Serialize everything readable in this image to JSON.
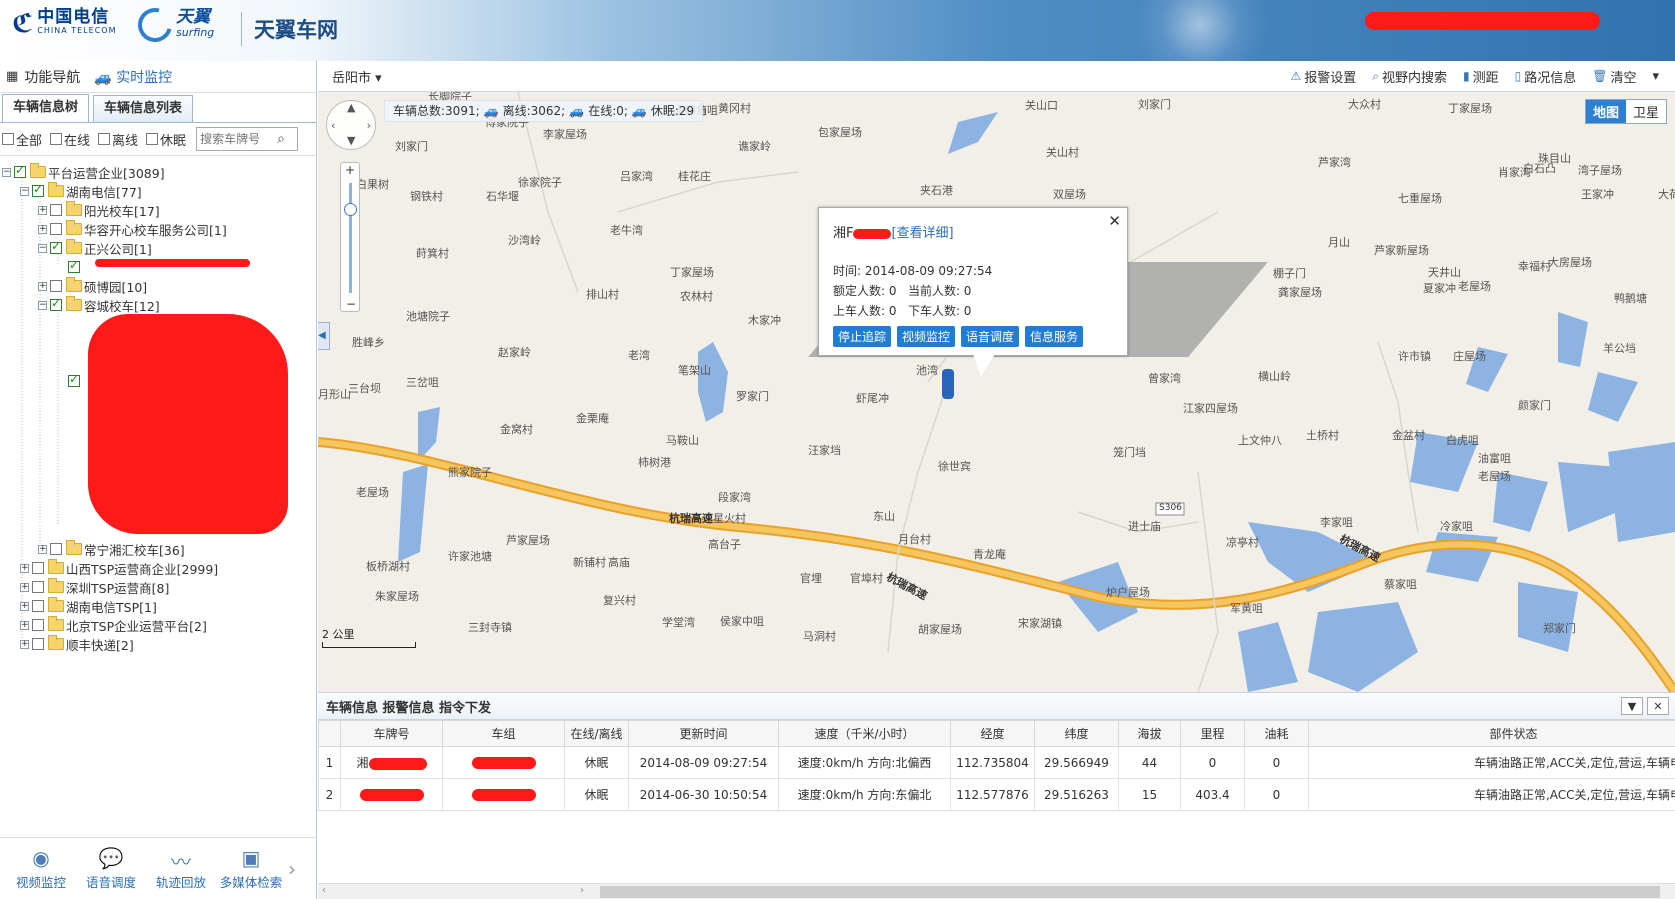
{
  "header": {
    "telecom_cn": "中国电信",
    "telecom_en": "CHINA TELECOM",
    "surfing_cn": "天翼",
    "surfing_en": "surfing",
    "app_title": "天翼车网"
  },
  "nav": {
    "func_nav": "功能导航",
    "realtime": "实时监控"
  },
  "left_tabs": [
    "车辆信息树",
    "车辆信息列表"
  ],
  "filters": {
    "all": "全部",
    "online": "在线",
    "offline": "离线",
    "sleep": "休眠",
    "search_placeholder": "搜索车牌号"
  },
  "tree": [
    {
      "label": "平台运营企业[3089]",
      "checked": true,
      "expanded": true
    },
    {
      "label": "湖南电信[77]",
      "checked": true,
      "expanded": true
    },
    {
      "label": "阳光校车[17]",
      "checked": false
    },
    {
      "label": "华容开心校车服务公司[1]",
      "checked": false
    },
    {
      "label": "正兴公司[1]",
      "checked": true,
      "expanded": true
    },
    {
      "label": "硕博园[10]",
      "checked": false
    },
    {
      "label": "容城校车[12]",
      "checked": true,
      "expanded": true
    },
    {
      "label": "常宁湘汇校车[36]",
      "checked": false
    },
    {
      "label": "山西TSP运营商企业[2999]",
      "checked": false
    },
    {
      "label": "深圳TSP运营商[8]",
      "checked": false
    },
    {
      "label": "湖南电信TSP[1]",
      "checked": false
    },
    {
      "label": "北京TSP企业运营平台[2]",
      "checked": false
    },
    {
      "label": "顺丰快递[2]",
      "checked": false
    }
  ],
  "left_footer": [
    "视频监控",
    "语音调度",
    "轨迹回放",
    "多媒体检索"
  ],
  "toolbar": {
    "city": "岳阳市",
    "tools": [
      "报警设置",
      "视野内搜索",
      "测距",
      "路况信息",
      "清空"
    ]
  },
  "map": {
    "stats": {
      "total": "车辆总数:3091;",
      "offline": "离线:3062;",
      "online": "在线:0;",
      "sleep": "休眠:29"
    },
    "type_map": "地图",
    "type_sat": "卫星",
    "scale_label": "2 公里",
    "popup": {
      "plate_prefix": "湘F",
      "detail_link": "[查看详细]",
      "time": "时间:  2014-08-09 09:27:54",
      "rated": "额定人数:  0",
      "current": "当前人数:  0",
      "on": "上车人数:  0",
      "off": "下车人数:  0",
      "buttons": [
        "停止追踪",
        "视频监控",
        "语音调度",
        "信息服务"
      ]
    },
    "places": [
      "子南角",
      "刘家门",
      "大众村",
      "丁家屋场",
      "关山口",
      "长脚院子",
      "傅家院子",
      "李家屋场",
      "刘家门",
      "谯家岭",
      "包家屋场",
      "关山村",
      "芦家湾",
      "珠目山",
      "白石凸",
      "肖家湾",
      "湾子屋场",
      "大荷塘",
      "白果树",
      "吕家湾",
      "桂花庄",
      "徐家院子",
      "钢铁村",
      "石华堰",
      "夹石港",
      "双屋场",
      "七重屋场",
      "王家冲",
      "芦家新屋场",
      "天井山",
      "大房屋场",
      "棚子门",
      "龚家屋场",
      "幸福村",
      "月山",
      "沙湾岭",
      "老牛湾",
      "黄冈村",
      "莳箕村",
      "丁家屋场",
      "农林村",
      "排山村",
      "夏家冲",
      "老屋场",
      "鸭鹅塘",
      "池塘院子",
      "木家冲",
      "胜峰乡",
      "赵家岭",
      "老湾",
      "笔架山",
      "月形山",
      "三岔咀",
      "许市镇",
      "庄屋场",
      "羊公垱",
      "曾家湾",
      "横山岭",
      "颜家门",
      "池湾",
      "虾尾冲",
      "罗家门",
      "金栗庵",
      "金窝村",
      "马鞍山",
      "汪家垱",
      "江家四屋场",
      "上文仲八",
      "土桥村",
      "金盆村",
      "白虎咀",
      "徐世宾",
      "笼门垱",
      "油富咀",
      "熊家院子",
      "段家湾",
      "柿树港",
      "老屋场",
      "芦家屋场",
      "板桥湖村",
      "星火村",
      "东山",
      "进士庙",
      "月台村",
      "高台子",
      "新铺村",
      "许家池塘",
      "青龙庵",
      "高庙",
      "官埠村",
      "官埋",
      "李家咀",
      "凉亭村",
      "冷家咀",
      "蔡家咀",
      "朱家屋场",
      "复兴村",
      "炉户屋场",
      "军黄咀",
      "学堂湾",
      "侯家中咀",
      "三封寺镇",
      "马洞村",
      "胡家屋场",
      "宋家湖镇",
      "郑家门",
      "三台坝",
      "老屋场",
      "大阳庙咀"
    ],
    "roads": [
      "杭瑞高速",
      "杭瑞高速",
      "杭瑞高速",
      "S306"
    ]
  },
  "bottom": {
    "title": "车辆信息 报警信息 指令下发",
    "columns": [
      "车牌号",
      "车组",
      "在线/离线",
      "更新时间",
      "速度（千米/小时）",
      "经度",
      "纬度",
      "海拔",
      "里程",
      "油耗",
      "部件状态"
    ],
    "rows": [
      {
        "idx": "1",
        "plate": "湘",
        "group": "",
        "status": "休眠",
        "time": "2014-08-09 09:27:54",
        "speed": "速度:0km/h 方向:北偏西",
        "lng": "112.735804",
        "lat": "29.566949",
        "alt": "44",
        "mileage": "0",
        "fuel": "0",
        "parts": "车辆油路正常,ACC关,定位,营运,车辆电路正常"
      },
      {
        "idx": "2",
        "plate": "",
        "group": "",
        "status": "休眠",
        "time": "2014-06-30 10:50:54",
        "speed": "速度:0km/h 方向:东偏北",
        "lng": "112.577876",
        "lat": "29.516263",
        "alt": "15",
        "mileage": "403.4",
        "fuel": "0",
        "parts": "车辆油路正常,ACC关,定位,营运,车辆电路正常"
      }
    ]
  },
  "colors": {
    "accent": "#2a6fb8",
    "button": "#1f7dd6",
    "redaction": "#ff1a1a",
    "water": "#8db3e2",
    "highway": "#f0b63d"
  }
}
